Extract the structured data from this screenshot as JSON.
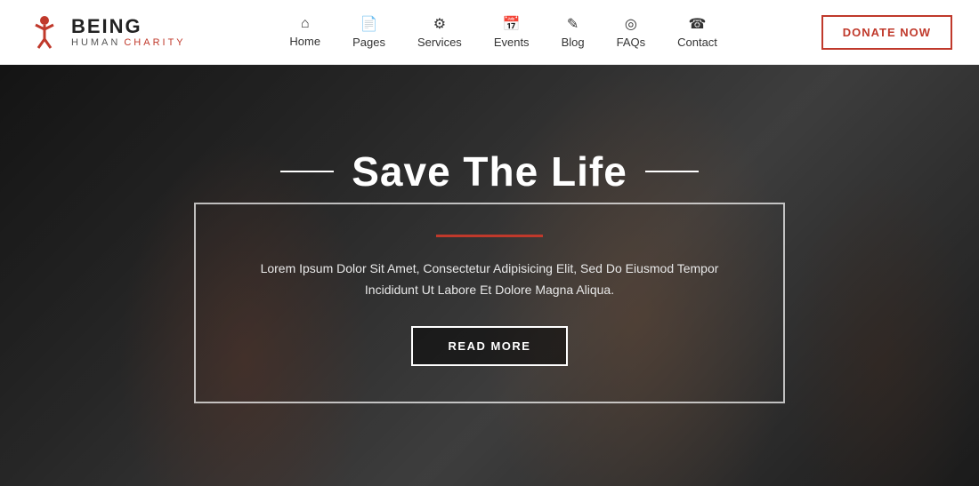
{
  "logo": {
    "being": "BEING",
    "human": "HUMAN",
    "charity": "CHARITY"
  },
  "nav": {
    "items": [
      {
        "id": "home",
        "icon": "⌂",
        "label": "Home"
      },
      {
        "id": "pages",
        "icon": "📄",
        "label": "Pages"
      },
      {
        "id": "services",
        "icon": "⚙",
        "label": "Services"
      },
      {
        "id": "events",
        "icon": "📅",
        "label": "Events"
      },
      {
        "id": "blog",
        "icon": "✎",
        "label": "Blog"
      },
      {
        "id": "faqs",
        "icon": "◎",
        "label": "FAQs"
      },
      {
        "id": "contact",
        "icon": "☎",
        "label": "Contact"
      }
    ],
    "donate_label": "DONATE NOW"
  },
  "hero": {
    "title": "Save The Life",
    "description": "Lorem Ipsum Dolor Sit Amet, Consectetur Adipisicing Elit, Sed Do Eiusmod Tempor Incididunt Ut Labore Et Dolore Magna Aliqua.",
    "read_more_label": "READ MORE"
  }
}
